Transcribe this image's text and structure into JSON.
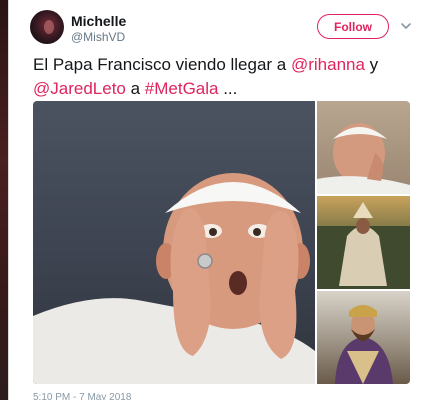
{
  "user": {
    "name": "Michelle",
    "handle": "@MishVD"
  },
  "actions": {
    "follow_label": "Follow"
  },
  "tweet": {
    "segments": [
      {
        "text": "El Papa Francisco viendo llegar a ",
        "link": false
      },
      {
        "text": "@rihanna",
        "link": true
      },
      {
        "text": " y ",
        "link": false
      },
      {
        "text": "@JaredLeto",
        "link": true
      },
      {
        "text": " a ",
        "link": false
      },
      {
        "text": "#MetGala",
        "link": true
      },
      {
        "text": " ...",
        "link": false
      }
    ],
    "timestamp": "5:10 PM - 7 May 2018"
  },
  "colors": {
    "accent": "#e0245e",
    "text": "#14171a",
    "muted": "#657786"
  },
  "icons": {
    "menu": "chevron-down-icon"
  }
}
